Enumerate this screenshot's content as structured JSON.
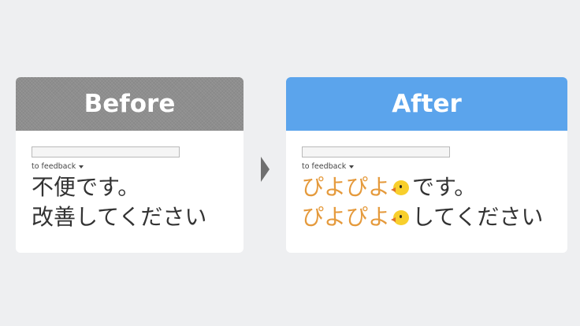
{
  "before": {
    "header": "Before",
    "dropdown_label": "to feedback",
    "line1": "不便です。",
    "line2": "改善してください"
  },
  "after": {
    "header": "After",
    "dropdown_label": "to feedback",
    "line1_orange": "ぴよぴよ",
    "line1_rest": "です。",
    "line2_orange": "ぴよぴよ",
    "line2_rest": "してください"
  },
  "icons": {
    "chick": "baby-chick-icon",
    "arrow": "right-arrow-icon",
    "caret": "caret-down-icon"
  },
  "colors": {
    "before_header": "#8e8e8e",
    "after_header": "#5ba4ec",
    "highlight": "#e59a3c",
    "background": "#eeeff1"
  }
}
